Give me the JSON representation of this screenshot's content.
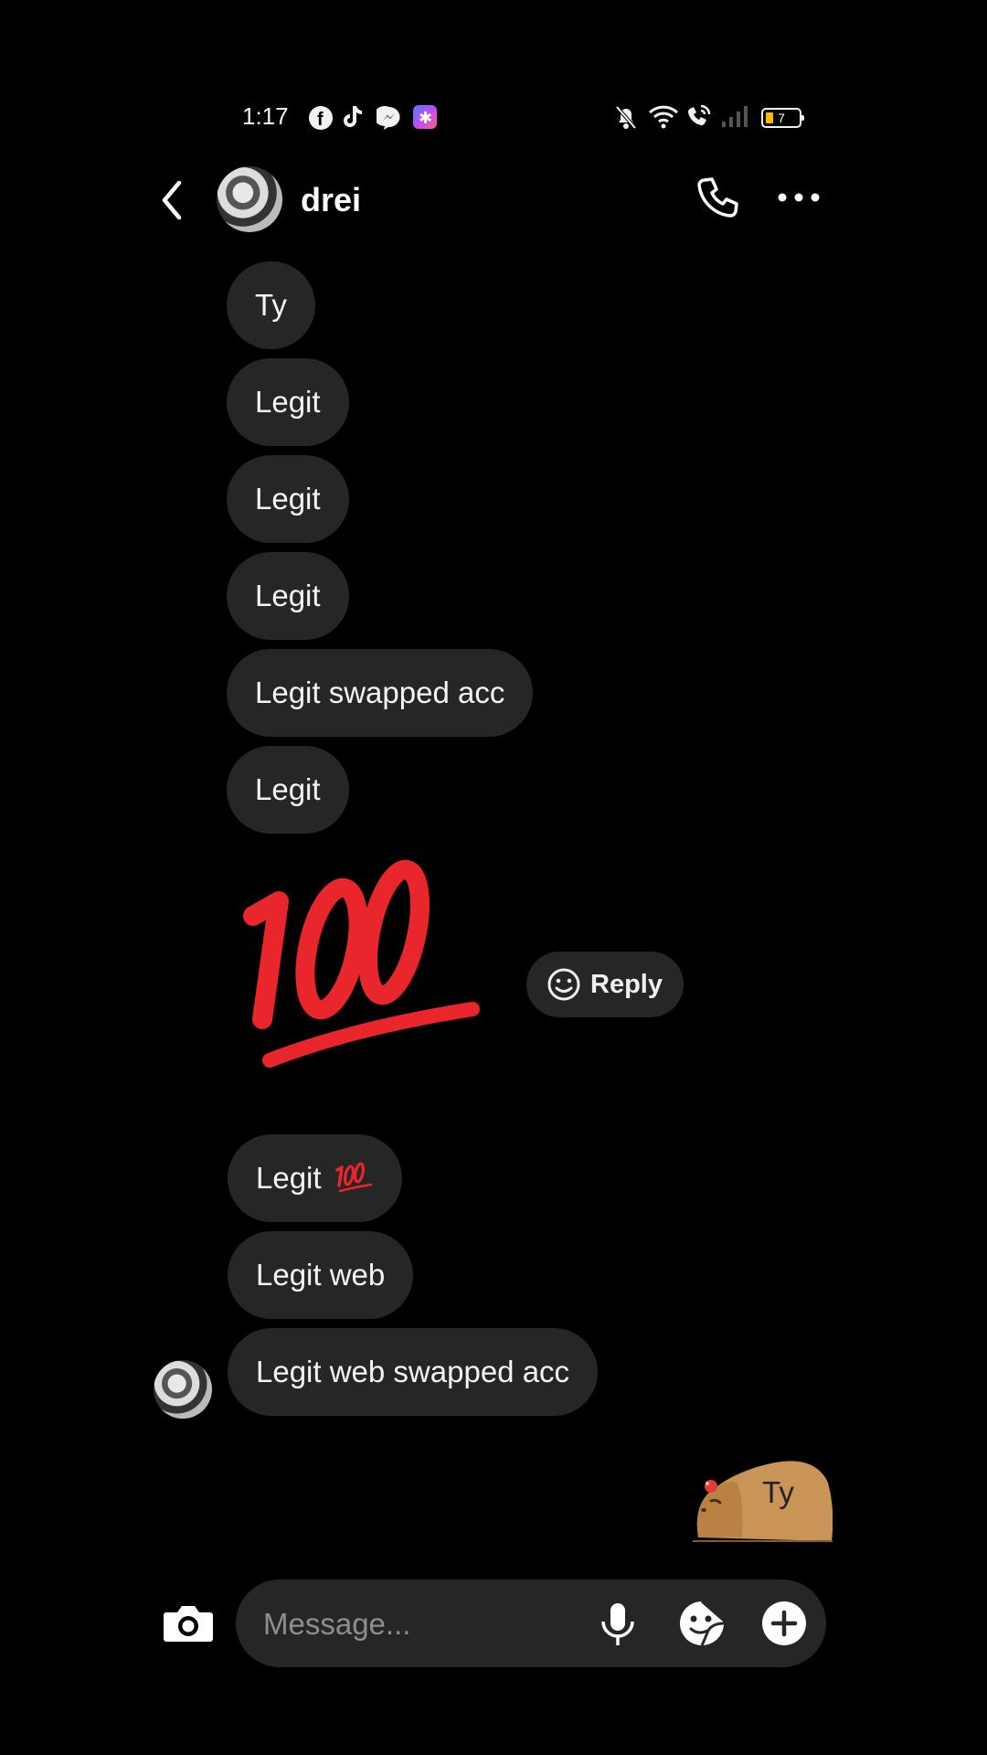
{
  "status_bar": {
    "time": "1:17",
    "battery_level": "7",
    "notification_icons": [
      "facebook-icon",
      "tiktok-icon",
      "messenger-icon",
      "app-icon"
    ],
    "system_icons": [
      "mute-icon",
      "wifi-icon",
      "wifi-calling-icon",
      "signal-icon",
      "battery-icon"
    ]
  },
  "header": {
    "username": "drei",
    "back_icon": "chevron-left-icon",
    "call_icon": "phone-icon",
    "more_icon": "more-horizontal-icon"
  },
  "messages": [
    {
      "text": "Ty"
    },
    {
      "text": "Legit"
    },
    {
      "text": "Legit"
    },
    {
      "text": "Legit"
    },
    {
      "text": "Legit swapped acc"
    },
    {
      "text": "Legit"
    },
    {
      "emoji": "100"
    },
    {
      "text": "Legit"
    },
    {
      "text": "Legit web"
    },
    {
      "text": "Legit web swapped acc"
    }
  ],
  "reply_label": "Reply",
  "sent_sticker_text": "Ty",
  "composer": {
    "placeholder": "Message...",
    "icons": [
      "camera-icon",
      "microphone-icon",
      "sticker-icon",
      "plus-icon"
    ]
  },
  "colors": {
    "background": "#000000",
    "bubble": "#262626",
    "hundred_emoji": "#e8262b",
    "battery": "#ffb800"
  }
}
